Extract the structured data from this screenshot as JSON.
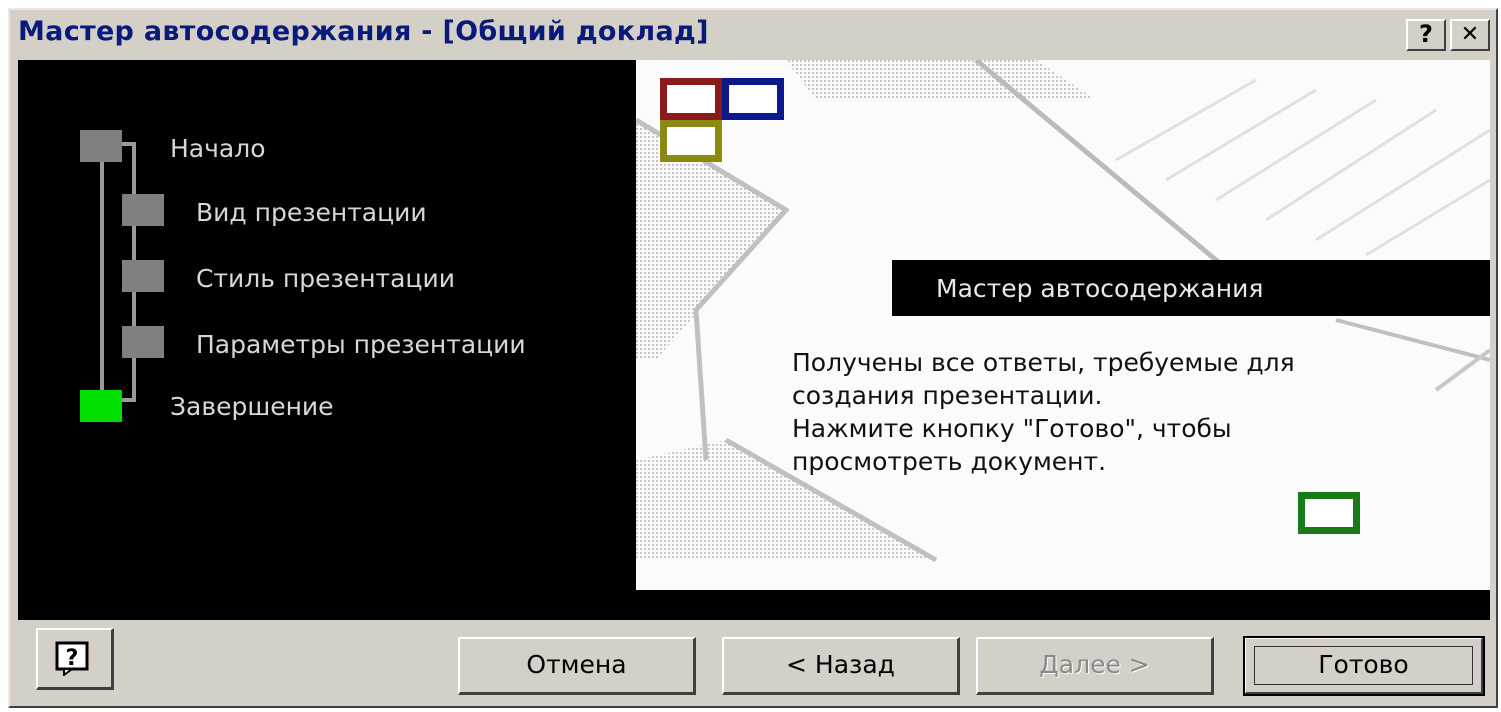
{
  "window": {
    "title": "Мастер автосодержания - [Общий доклад]",
    "help_button": "?",
    "close_button": "✕"
  },
  "steps": [
    {
      "label": "Начало",
      "state": "done"
    },
    {
      "label": "Вид презентации",
      "state": "done"
    },
    {
      "label": "Стиль презентации",
      "state": "done"
    },
    {
      "label": "Параметры презентации",
      "state": "done"
    },
    {
      "label": "Завершение",
      "state": "current"
    }
  ],
  "main": {
    "heading": "Мастер автосодержания",
    "message": [
      "Получены все ответы, требуемые для",
      "создания презентации.",
      "Нажмите кнопку \"Готово\", чтобы",
      "просмотреть документ."
    ]
  },
  "footer": {
    "help_icon": "help-icon",
    "cancel": "Отмена",
    "back": "< Назад",
    "next": "Далее >",
    "finish": "Готово"
  },
  "colors": {
    "title_text": "#0a1a7a",
    "step_done": "#808080",
    "step_current": "#00e000",
    "square_red": "#8b1a1a",
    "square_blue": "#0a1a8a",
    "square_olive": "#8a8a10",
    "square_green": "#1a7a1a"
  }
}
